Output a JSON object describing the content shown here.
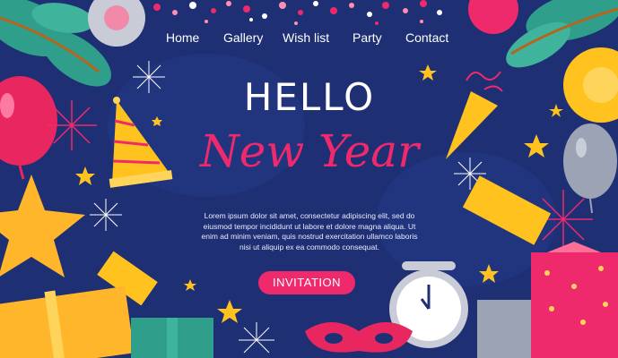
{
  "nav": {
    "items": [
      {
        "label": "Home"
      },
      {
        "label": "Gallery"
      },
      {
        "label": "Wish list"
      },
      {
        "label": "Party"
      },
      {
        "label": "Contact"
      }
    ]
  },
  "hero": {
    "hello": "HELLO",
    "new_year": "New Year",
    "body": "Lorem ipsum dolor sit amet, consectetur adipiscing elit, sed do eiusmod tempor incididunt ut labore et dolore magna aliqua. Ut enim ad minim veniam, quis nostrud exercitation ullamco laboris nisi ut aliquip ex ea commodo consequat.",
    "cta_label": "INVITATION"
  },
  "colors": {
    "background": "#1f2f73",
    "accent_pink": "#ee2a6d",
    "text": "#ffffff"
  },
  "icons": [
    "balloon-icon",
    "party-hat-icon",
    "star-icon",
    "firework-icon",
    "gift-box-icon",
    "alarm-clock-icon",
    "party-popper-icon",
    "carnival-mask-icon",
    "leaf-branch-icon"
  ]
}
